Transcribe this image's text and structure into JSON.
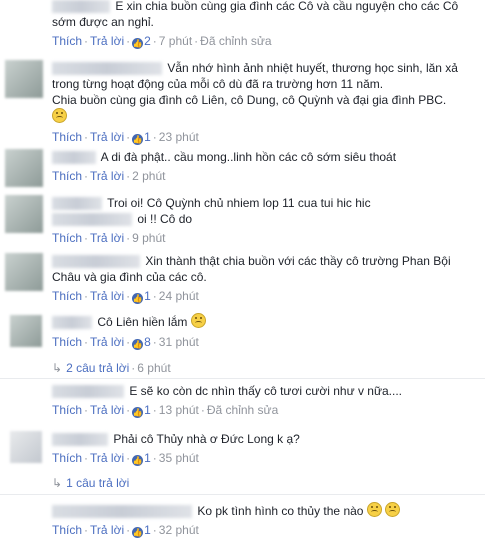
{
  "ui": {
    "like": "Thích",
    "reply": "Trả lời",
    "edited": "Đã chỉnh sửa",
    "dot": "·"
  },
  "comments": [
    {
      "text": "E xin chia buồn cùng gia đình các Cô và cầu nguyện cho các Cô sớm được an nghỉ.",
      "likes": "2",
      "time": "7 phút",
      "edited": true
    },
    {
      "text": "Vẫn nhớ hình ảnh nhiệt huyết, thương học sinh, lăn xả trong từng hoạt động của mỗi cô dù đã ra trường hơn 11 năm.",
      "text2": "Chia buồn cùng gia đình cô Liên, cô Dung, cô Quỳnh và đại gia đình PBC.",
      "likes": "1",
      "time": "23 phút"
    },
    {
      "text": "A di đà phật.. cầu mong..linh hồn các cô sớm siêu thoát",
      "time": "2 phút"
    },
    {
      "text": "Troi oi! Cô Quỳnh chủ nhiem lop 11 cua tui hic hic",
      "text2": "oi !! Cô do",
      "time": "9 phút"
    },
    {
      "text": "Xin thành thật chia buồn với các thầy cô trường Phan Bội Châu và gia đình của các cô.",
      "likes": "1",
      "time": "24 phút"
    },
    {
      "text": "Cô Liên hiền lắm",
      "likes": "8",
      "time": "31 phút",
      "replies": "2 câu trả lời",
      "replies_time": "6 phút"
    },
    {
      "text": "E sẽ ko còn dc nhìn thấy cô tươi cười như v nữa....",
      "likes": "1",
      "time": "13 phút",
      "edited": true
    },
    {
      "text": "Phải cô Thủy nhà ơ Đức Long k ạ?",
      "likes": "1",
      "time": "35 phút",
      "replies": "1 câu trả lời"
    },
    {
      "text": "Ko pk tình hình co thủy the nào",
      "likes": "1",
      "time": "32 phút"
    }
  ]
}
